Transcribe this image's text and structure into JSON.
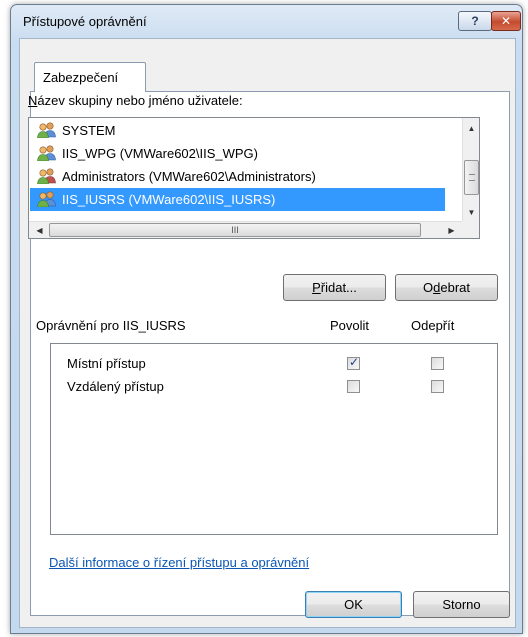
{
  "window": {
    "title": "Přístupové oprávnění",
    "help_label": "?",
    "close_label": "✕"
  },
  "tabs": [
    {
      "label": "Zabezpečení",
      "active": true
    }
  ],
  "groups": {
    "label": "Název skupiny nebo jméno uživatele:",
    "items": [
      {
        "label": "SYSTEM",
        "selected": false
      },
      {
        "label": "IIS_WPG (VMWare602\\IIS_WPG)",
        "selected": false
      },
      {
        "label": "Administrators (VMWare602\\Administrators)",
        "selected": false
      },
      {
        "label": "IIS_IUSRS (VMWare602\\IIS_IUSRS)",
        "selected": true
      }
    ],
    "hscroll_grip": "III"
  },
  "buttons": {
    "add": "Přidat...",
    "remove": "Odebrat",
    "ok": "OK",
    "cancel": "Storno"
  },
  "permissions": {
    "title": "Oprávnění pro IIS_IUSRS",
    "col_allow": "Povolit",
    "col_deny": "Odepřít",
    "rows": [
      {
        "label": "Místní přístup",
        "allow": true,
        "deny": false
      },
      {
        "label": "Vzdálený přístup",
        "allow": false,
        "deny": false
      }
    ]
  },
  "link": "Další informace o řízení přístupu a oprávnění",
  "colors": {
    "selection": "#3399ff",
    "link": "#0b56b3"
  }
}
